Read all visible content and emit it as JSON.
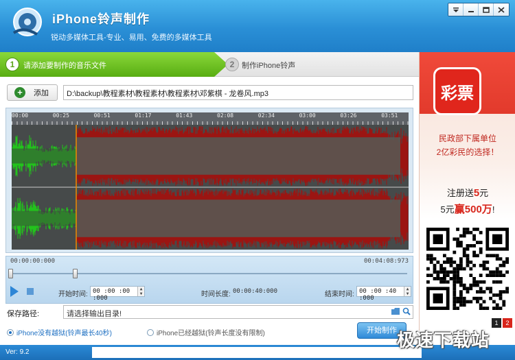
{
  "window": {
    "title": "iPhone铃声制作",
    "subtitle": "锐动多媒体工具-专业、易用、免费的多媒体工具",
    "buttons": [
      "menu",
      "minimize",
      "maximize",
      "close"
    ]
  },
  "steps": [
    {
      "num": "1",
      "label": "请添加要制作的音乐文件",
      "active": true,
      "color": "#6dc31e"
    },
    {
      "num": "2",
      "label": "制作iPhone铃声",
      "active": false
    }
  ],
  "file": {
    "add_label": "添加",
    "path": "D:\\backup\\教程素材\\教程素材\\教程素材\\邓紫棋 - 龙卷风.mp3"
  },
  "ruler": {
    "ticks": [
      "00:00",
      "00:25",
      "00:51",
      "01:17",
      "01:43",
      "02:08",
      "02:34",
      "03:00",
      "03:26",
      "03:51"
    ]
  },
  "waveform": {
    "selected_fraction_end": 0.163,
    "selected_color": "#22c31c",
    "unselected_color": "#9b1512"
  },
  "timeline": {
    "start_time": "00:00:00:000",
    "end_time": "00:04:08:973",
    "start_label": "开始时间:",
    "start_value": "00 :00 :00 :000",
    "duration_label": "时间长度:",
    "duration_value": "00:00:40:000",
    "end_label": "结束时间:",
    "end_value": "00 :00 :40 :000"
  },
  "save": {
    "label": "保存路径:",
    "placeholder": "请选择输出目录!"
  },
  "options": [
    {
      "label": "iPhone没有越狱(铃声最长40秒)",
      "selected": true
    },
    {
      "label": "iPhone已经越狱(铃声长度没有限制)",
      "selected": false
    }
  ],
  "start_button": "开始制作",
  "ad": {
    "logo_text": "彩票",
    "line1": "民政部下属单位",
    "line2": "2亿彩民的选择！",
    "line3_pre": "注册送",
    "line3_num": "5",
    "line3_post": "元",
    "line4_pre": "5元",
    "line4_em": "赢500万",
    "line4_post": "!",
    "pages": [
      "1",
      "2"
    ]
  },
  "status": {
    "version": "Ver: 9.2"
  },
  "watermark": "极速下载站"
}
